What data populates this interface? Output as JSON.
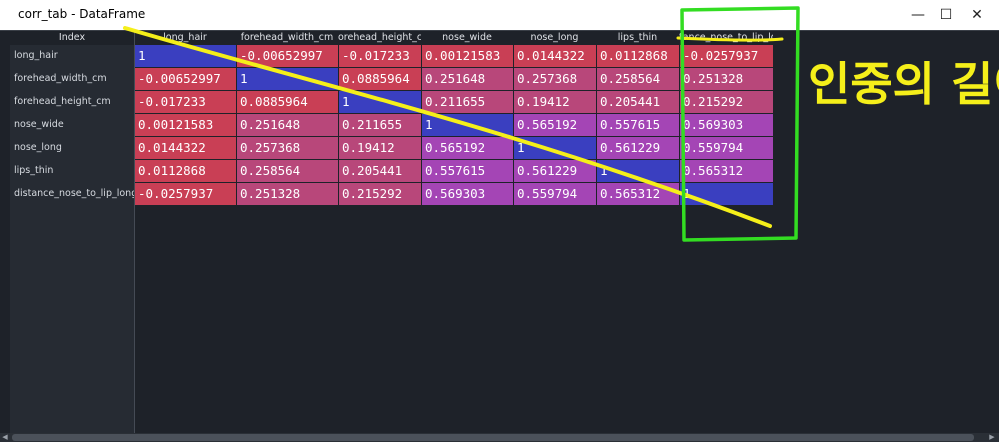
{
  "window": {
    "title": "corr_tab - DataFrame",
    "controls": {
      "minimize": "—",
      "maximize": "☐",
      "close": "✕"
    }
  },
  "table": {
    "index_header": "Index",
    "columns": [
      "long_hair",
      "forehead_width_cm",
      "orehead_height_cr",
      "nose_wide",
      "nose_long",
      "lips_thin",
      "tance_nose_to_lip_lo"
    ],
    "rows": [
      {
        "label": "long_hair",
        "cells": [
          "1",
          "-0.00652997",
          "-0.017233",
          "0.00121583",
          "0.0144322",
          "0.0112868",
          "-0.0257937"
        ]
      },
      {
        "label": "forehead_width_cm",
        "cells": [
          "-0.00652997",
          "1",
          "0.0885964",
          "0.251648",
          "0.257368",
          "0.258564",
          "0.251328"
        ]
      },
      {
        "label": "forehead_height_cm",
        "cells": [
          "-0.017233",
          "0.0885964",
          "1",
          "0.211655",
          "0.19412",
          "0.205441",
          "0.215292"
        ]
      },
      {
        "label": "nose_wide",
        "cells": [
          "0.00121583",
          "0.251648",
          "0.211655",
          "1",
          "0.565192",
          "0.557615",
          "0.569303"
        ]
      },
      {
        "label": "nose_long",
        "cells": [
          "0.0144322",
          "0.257368",
          "0.19412",
          "0.565192",
          "1",
          "0.561229",
          "0.559794"
        ]
      },
      {
        "label": "lips_thin",
        "cells": [
          "0.0112868",
          "0.258564",
          "0.205441",
          "0.557615",
          "0.561229",
          "1",
          "0.565312"
        ]
      },
      {
        "label": "distance_nose_to_lip_long",
        "cells": [
          "-0.0257937",
          "0.251328",
          "0.215292",
          "0.569303",
          "0.559794",
          "0.565312",
          "1"
        ]
      }
    ]
  },
  "annotation": {
    "handwritten_text": "인중의 길이",
    "pen_colors": {
      "yellow": "#f5ef1a",
      "green": "#33dd22"
    }
  },
  "colors": {
    "diagonal": "#3a3fc0",
    "low": "#c93f55",
    "mid": "#b8477a",
    "high": "#a445b5",
    "background": "#1e2229"
  }
}
